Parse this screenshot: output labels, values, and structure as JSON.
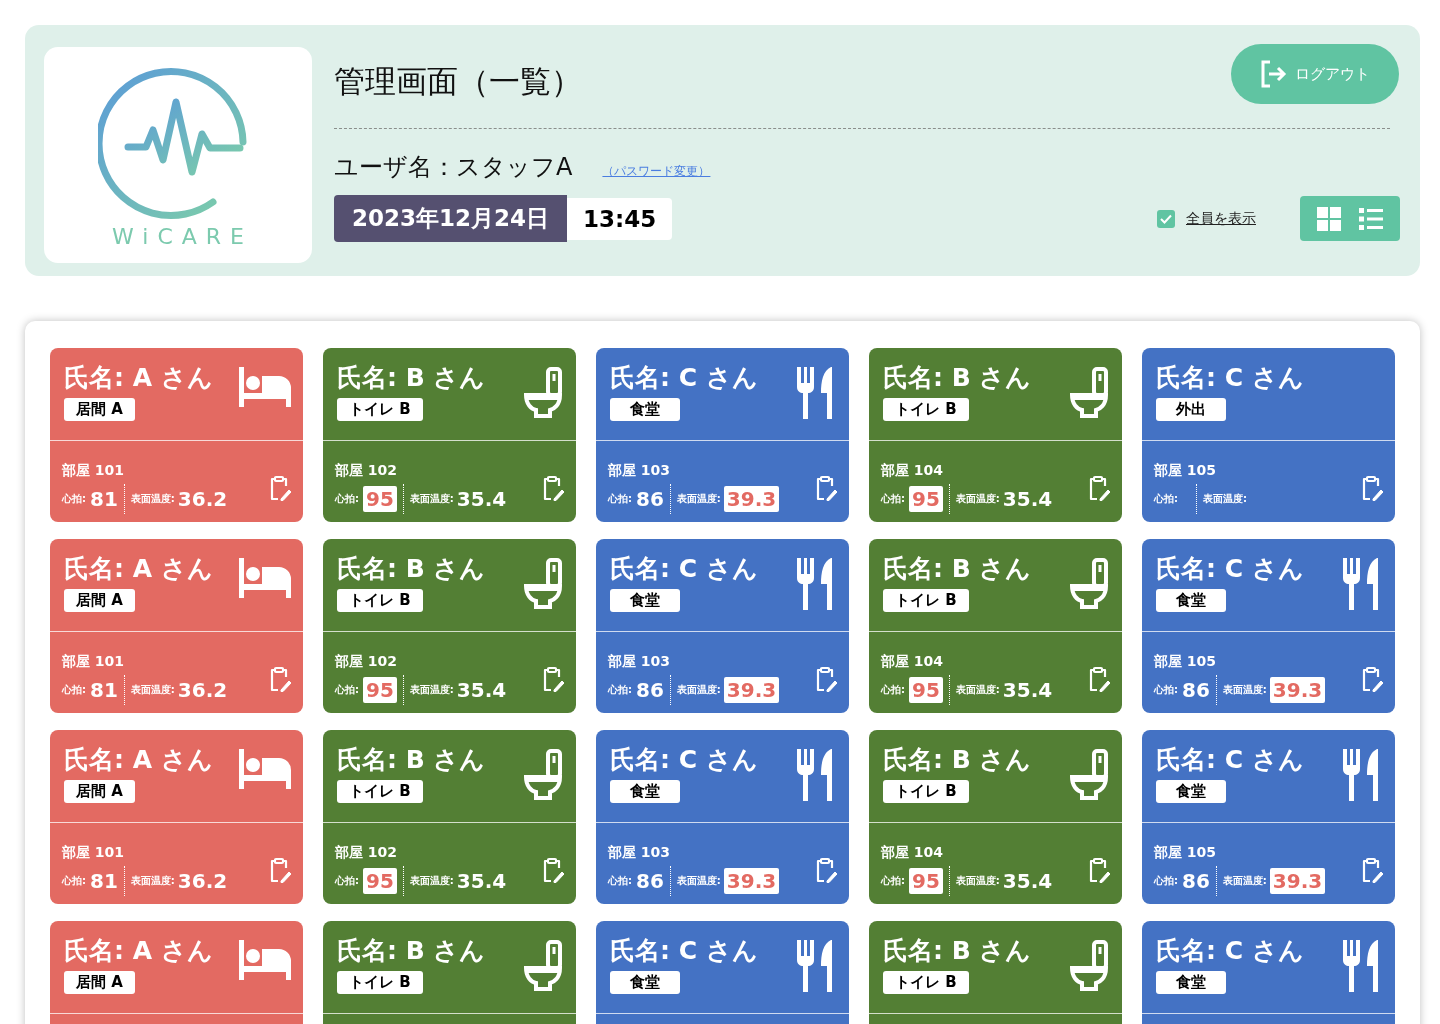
{
  "header": {
    "logo_text": "WiCARE",
    "title": "管理画面（一覧）",
    "user_label": "ユーザ名：スタッフA",
    "password_link": "（パスワード変更）",
    "date": "2023年12月24日",
    "time": "13:45",
    "logout_button": "ログアウト",
    "show_all": {
      "label": "全員を表示",
      "checked": true
    }
  },
  "cards": [
    {
      "kind": "bed",
      "color": "#e36a62",
      "name": "氏名: A さん",
      "location": "居間 A",
      "room": "部屋 101",
      "heart_label": "心拍:",
      "heart": "81",
      "heart_alert": false,
      "temp_label": "表面温度:",
      "temp": "36.2",
      "temp_alert": false
    },
    {
      "kind": "toilet",
      "color": "#537f34",
      "name": "氏名: B さん",
      "location": "トイレ B",
      "room": "部屋 102",
      "heart_label": "心拍:",
      "heart": "95",
      "heart_alert": true,
      "temp_label": "表面温度:",
      "temp": "35.4",
      "temp_alert": false
    },
    {
      "kind": "dining",
      "color": "#4472c4",
      "name": "氏名: C さん",
      "location": "食堂",
      "room": "部屋 103",
      "heart_label": "心拍:",
      "heart": "86",
      "heart_alert": false,
      "temp_label": "表面温度:",
      "temp": "39.3",
      "temp_alert": true
    },
    {
      "kind": "toilet",
      "color": "#537f34",
      "name": "氏名: B さん",
      "location": "トイレ B",
      "room": "部屋 104",
      "heart_label": "心拍:",
      "heart": "95",
      "heart_alert": true,
      "temp_label": "表面温度:",
      "temp": "35.4",
      "temp_alert": false
    },
    {
      "kind": "away",
      "color": "#4472c4",
      "name": "氏名: C さん",
      "location": "外出",
      "room": "部屋 105",
      "heart_label": "心拍:",
      "temp_label": "表面温度:"
    },
    {
      "kind": "bed",
      "color": "#e36a62",
      "name": "氏名: A さん",
      "location": "居間 A",
      "room": "部屋 101",
      "heart_label": "心拍:",
      "heart": "81",
      "heart_alert": false,
      "temp_label": "表面温度:",
      "temp": "36.2",
      "temp_alert": false
    },
    {
      "kind": "toilet",
      "color": "#537f34",
      "name": "氏名: B さん",
      "location": "トイレ B",
      "room": "部屋 102",
      "heart_label": "心拍:",
      "heart": "95",
      "heart_alert": true,
      "temp_label": "表面温度:",
      "temp": "35.4",
      "temp_alert": false
    },
    {
      "kind": "dining",
      "color": "#4472c4",
      "name": "氏名: C さん",
      "location": "食堂",
      "room": "部屋 103",
      "heart_label": "心拍:",
      "heart": "86",
      "heart_alert": false,
      "temp_label": "表面温度:",
      "temp": "39.3",
      "temp_alert": true
    },
    {
      "kind": "toilet",
      "color": "#537f34",
      "name": "氏名: B さん",
      "location": "トイレ B",
      "room": "部屋 104",
      "heart_label": "心拍:",
      "heart": "95",
      "heart_alert": true,
      "temp_label": "表面温度:",
      "temp": "35.4",
      "temp_alert": false
    },
    {
      "kind": "dining",
      "color": "#4472c4",
      "name": "氏名: C さん",
      "location": "食堂",
      "room": "部屋 105",
      "heart_label": "心拍:",
      "heart": "86",
      "heart_alert": false,
      "temp_label": "表面温度:",
      "temp": "39.3",
      "temp_alert": true
    },
    {
      "kind": "bed",
      "color": "#e36a62",
      "name": "氏名: A さん",
      "location": "居間 A",
      "room": "部屋 101",
      "heart_label": "心拍:",
      "heart": "81",
      "heart_alert": false,
      "temp_label": "表面温度:",
      "temp": "36.2",
      "temp_alert": false
    },
    {
      "kind": "toilet",
      "color": "#537f34",
      "name": "氏名: B さん",
      "location": "トイレ B",
      "room": "部屋 102",
      "heart_label": "心拍:",
      "heart": "95",
      "heart_alert": true,
      "temp_label": "表面温度:",
      "temp": "35.4",
      "temp_alert": false
    },
    {
      "kind": "dining",
      "color": "#4472c4",
      "name": "氏名: C さん",
      "location": "食堂",
      "room": "部屋 103",
      "heart_label": "心拍:",
      "heart": "86",
      "heart_alert": false,
      "temp_label": "表面温度:",
      "temp": "39.3",
      "temp_alert": true
    },
    {
      "kind": "toilet",
      "color": "#537f34",
      "name": "氏名: B さん",
      "location": "トイレ B",
      "room": "部屋 104",
      "heart_label": "心拍:",
      "heart": "95",
      "heart_alert": true,
      "temp_label": "表面温度:",
      "temp": "35.4",
      "temp_alert": false
    },
    {
      "kind": "dining",
      "color": "#4472c4",
      "name": "氏名: C さん",
      "location": "食堂",
      "room": "部屋 105",
      "heart_label": "心拍:",
      "heart": "86",
      "heart_alert": false,
      "temp_label": "表面温度:",
      "temp": "39.3",
      "temp_alert": true
    },
    {
      "kind": "bed",
      "color": "#e36a62",
      "name": "氏名: A さん",
      "location": "居間 A"
    },
    {
      "kind": "toilet",
      "color": "#537f34",
      "name": "氏名: B さん",
      "location": "トイレ B"
    },
    {
      "kind": "dining",
      "color": "#4472c4",
      "name": "氏名: C さん",
      "location": "食堂"
    },
    {
      "kind": "toilet",
      "color": "#537f34",
      "name": "氏名: B さん",
      "location": "トイレ B"
    },
    {
      "kind": "dining",
      "color": "#4472c4",
      "name": "氏名: C さん",
      "location": "食堂"
    }
  ]
}
